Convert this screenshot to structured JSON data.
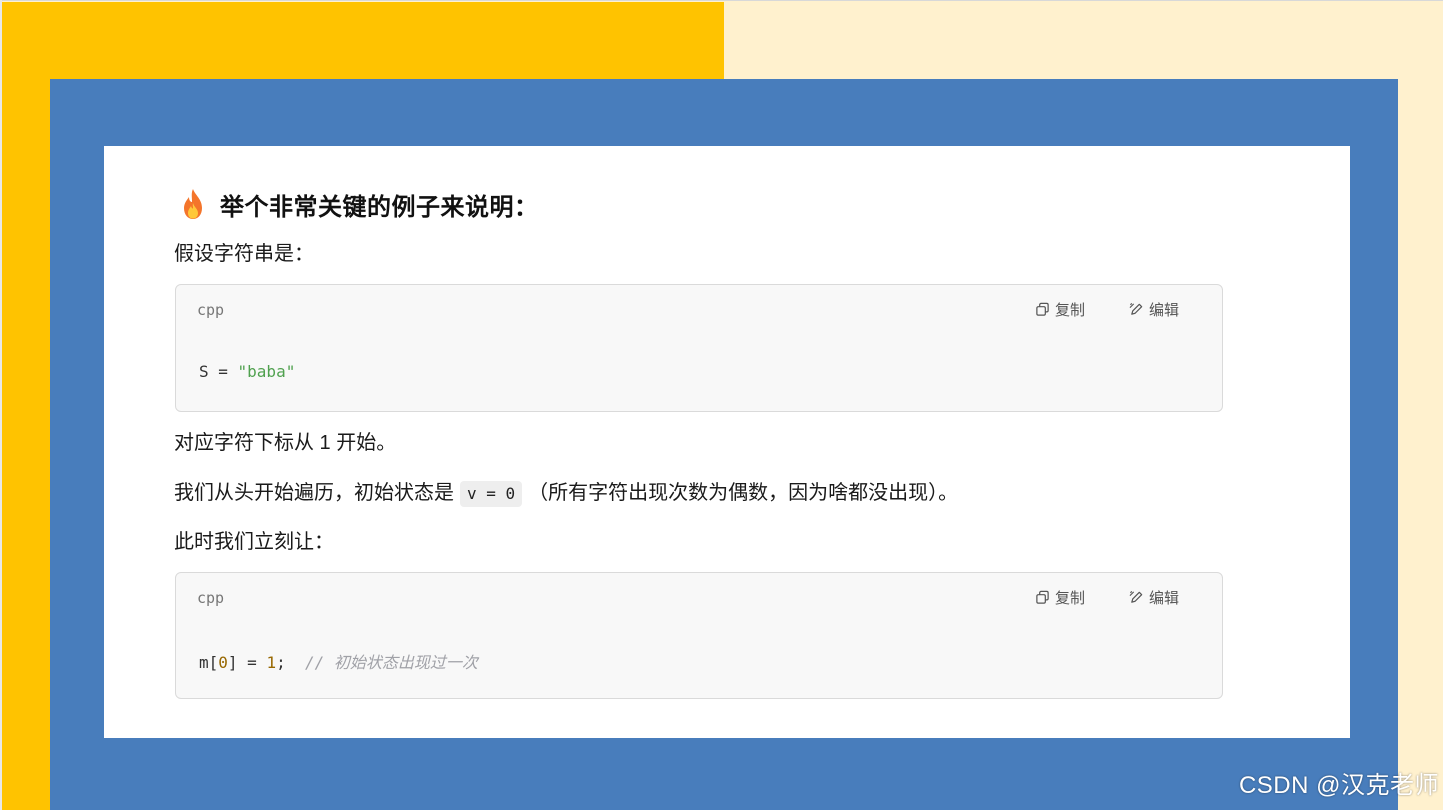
{
  "heading": {
    "icon": "fire-icon",
    "text": "举个非常关键的例子来说明："
  },
  "paragraphs": {
    "p1": "假设字符串是：",
    "p2": "对应字符下标从 1 开始。",
    "p3_before": "我们从头开始遍历，初始状态是",
    "p3_code": "v = 0",
    "p3_after": "（所有字符出现次数为偶数，因为啥都没出现）。",
    "p4": "此时我们立刻让："
  },
  "code_blocks": [
    {
      "language": "cpp",
      "copy_label": "复制",
      "edit_label": "编辑",
      "tokens": {
        "ident": "S = ",
        "string": "\"baba\""
      }
    },
    {
      "language": "cpp",
      "copy_label": "复制",
      "edit_label": "编辑",
      "tokens": {
        "t1": "m[",
        "n1": "0",
        "t2": "] = ",
        "n2": "1",
        "t3": ";  ",
        "comment": "// 初始状态出现过一次"
      }
    }
  ],
  "watermark": "CSDN @汉克老师",
  "colors": {
    "yellow": "#FFC300",
    "cream": "#FFF1CE",
    "blue": "#487DBC",
    "string_green": "#50A14F",
    "number_brown": "#986801"
  }
}
